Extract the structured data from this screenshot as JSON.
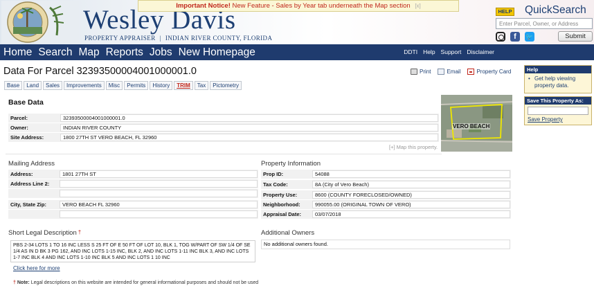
{
  "header": {
    "brand_title": "Wesley Davis",
    "brand_sub_left": "PROPERTY APPRAISER",
    "brand_sub_sep": "|",
    "brand_sub_right": "INDIAN RIVER COUNTY, FLORIDA",
    "notice_bold": "Important Notice!",
    "notice_text": "New Feature - Sales by Year tab underneath the Map section",
    "notice_close": "[x]",
    "help_badge": "HELP",
    "quicksearch_title": "QuickSearch",
    "search_placeholder": "Enter Parcel, Owner, or Address",
    "submit_label": "Submit",
    "facebook_glyph": "f",
    "twitter_glyph": "🐦"
  },
  "nav": {
    "main": [
      "Home",
      "Search",
      "Map",
      "Reports",
      "Jobs",
      "New Homepage"
    ],
    "right": [
      "DDTI",
      "Help",
      "Support",
      "Disclaimer"
    ]
  },
  "page": {
    "title": "Data For Parcel 32393500004001000001.0",
    "actions": {
      "print": "Print",
      "email": "Email",
      "property_card": "Property Card"
    },
    "tabs": [
      "Base",
      "Land",
      "Sales",
      "Improvements",
      "Misc",
      "Permits",
      "History",
      "TRIM",
      "Tax",
      "Pictometry"
    ]
  },
  "base_data": {
    "heading": "Base Data",
    "rows": [
      {
        "label": "Parcel:",
        "value": "32393500004001000001.0"
      },
      {
        "label": "Owner:",
        "value": "INDIAN RIVER COUNTY"
      },
      {
        "label": "Site Address:",
        "value": "1800 27TH ST VERO BEACH, FL 32960"
      }
    ],
    "map_link": "[+] Map this property.",
    "aerial_label": "VERO BEACH"
  },
  "mailing": {
    "heading": "Mailing Address",
    "rows": [
      {
        "label": "Address:",
        "value": "1801 27TH ST"
      },
      {
        "label": "Address Line 2:",
        "value": ""
      },
      {
        "label": "",
        "value": ""
      },
      {
        "label": "City, State Zip:",
        "value": "VERO BEACH FL 32960"
      },
      {
        "label": "",
        "value": ""
      }
    ]
  },
  "property_info": {
    "heading": "Property Information",
    "rows": [
      {
        "label": "Prop ID:",
        "value": "54088"
      },
      {
        "label": "Tax Code:",
        "value": "8A  (City of Vero Beach)"
      },
      {
        "label": "Property Use:",
        "value": "8600  (COUNTY FORECLOSED/OWNED)"
      },
      {
        "label": "Neighborhood:",
        "value": "990055.00  (ORIGINAL TOWN OF VERO)"
      },
      {
        "label": "Appraisal Date:",
        "value": "03/07/2018"
      }
    ]
  },
  "legal": {
    "heading": "Short Legal Description",
    "dagger": "†",
    "text": "PBS 2-34 LOTS 1 TO 16 INC LESS S 25 FT OF E 50 FT OF LOT 10, BLK 1, TOG W/PART OF SW 1/4 OF SE 1/4 AS IN D BK 3 PG 162, AND INC LOTS 1-15 INC, BLK 2, AND INC LOTS 1-11 INC BLK 3, AND INC LOTS 1-7 INC BLK 4 AND INC LOTS 1-10 INC BLK 5 AND INC LOTS 1 10 INC",
    "click_more": "Click here for more",
    "note_prefix": "Note:",
    "note_text": "Legal descriptions on this website are intended for general informational purposes and should not be used"
  },
  "owners": {
    "heading": "Additional Owners",
    "empty_text": "No additional owners found."
  },
  "sidebar": {
    "help_heading": "Help",
    "help_item": "Get help viewing property data.",
    "save_heading": "Save This Property As:",
    "save_link": "Save Property"
  }
}
